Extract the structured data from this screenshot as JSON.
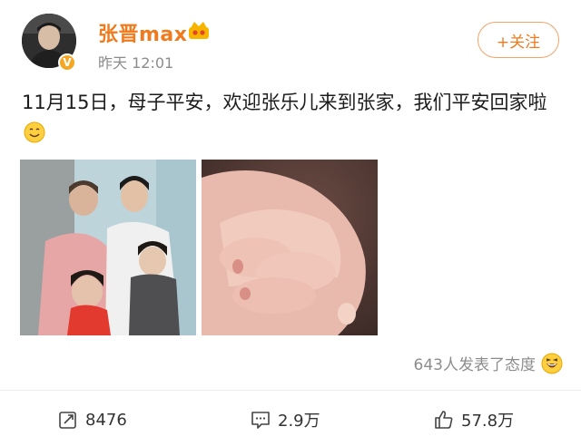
{
  "user": {
    "name": "张晋max",
    "verified_badge": "V",
    "time": "昨天 12:01"
  },
  "follow_button": "+关注",
  "post": {
    "text": "11月15日，母子平安，欢迎张乐儿来到张家，我们平安回家啦"
  },
  "reactions": {
    "summary": "643人发表了态度"
  },
  "actions": {
    "repost_count": "8476",
    "comment_count": "2.9万",
    "like_count": "57.8万"
  },
  "colors": {
    "accent": "#f07a1e",
    "muted": "#8c8c8c"
  }
}
